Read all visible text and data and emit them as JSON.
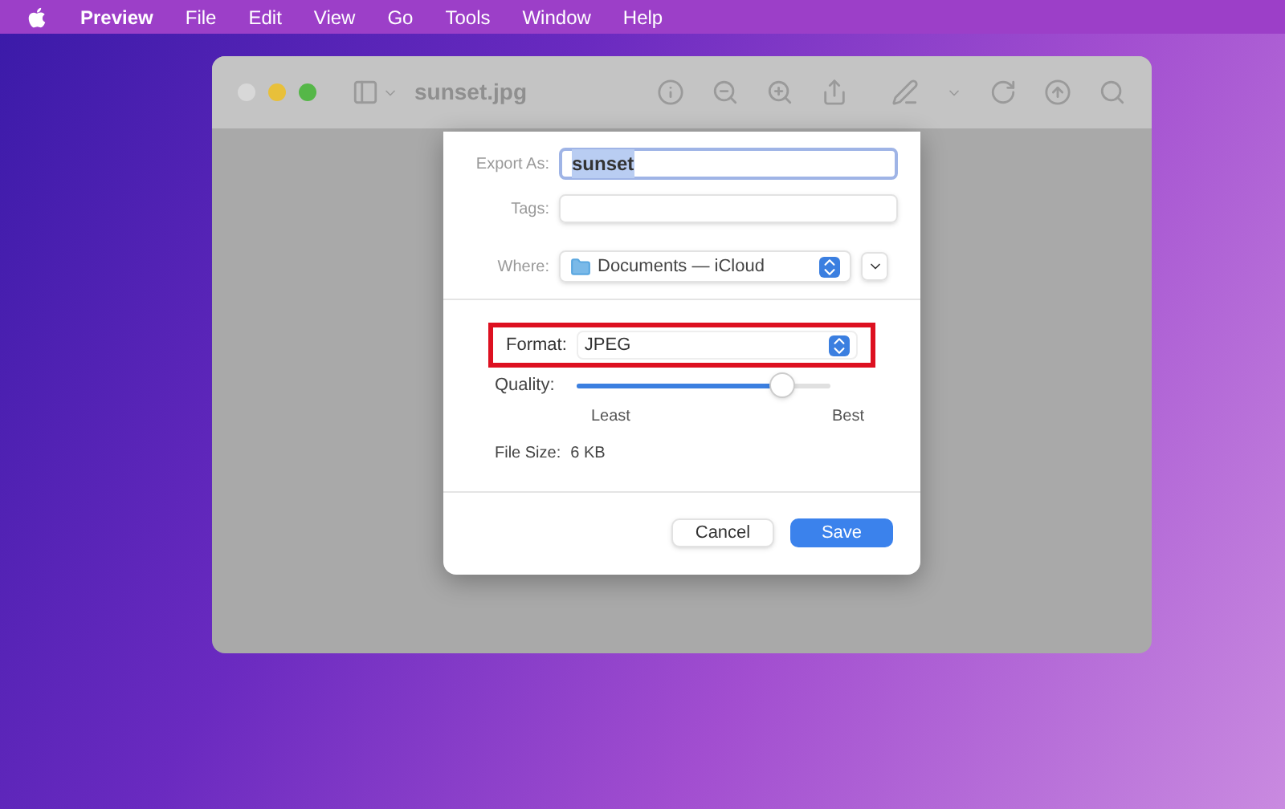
{
  "menu_bar": {
    "items": [
      {
        "label": "Preview",
        "kind": "app"
      },
      {
        "label": "File",
        "kind": "menu"
      },
      {
        "label": "Edit",
        "kind": "menu"
      },
      {
        "label": "View",
        "kind": "menu"
      },
      {
        "label": "Go",
        "kind": "menu"
      },
      {
        "label": "Tools",
        "kind": "menu"
      },
      {
        "label": "Window",
        "kind": "menu"
      },
      {
        "label": "Help",
        "kind": "menu"
      }
    ]
  },
  "window": {
    "title": "sunset.jpg"
  },
  "export_dialog": {
    "export_as": {
      "label": "Export As:",
      "value": "sunset"
    },
    "tags": {
      "label": "Tags:"
    },
    "where": {
      "label": "Where:",
      "value": "Documents — iCloud"
    },
    "format": {
      "label": "Format:",
      "value": "JPEG",
      "highlighted": true
    },
    "quality": {
      "label": "Quality:",
      "level": 0.81,
      "min_label": "Least",
      "max_label": "Best"
    },
    "file_size": {
      "label": "File Size:",
      "value": "6 KB"
    },
    "buttons": [
      {
        "label": "Cancel",
        "kind": "secondary"
      },
      {
        "label": "Save",
        "kind": "primary"
      }
    ]
  }
}
